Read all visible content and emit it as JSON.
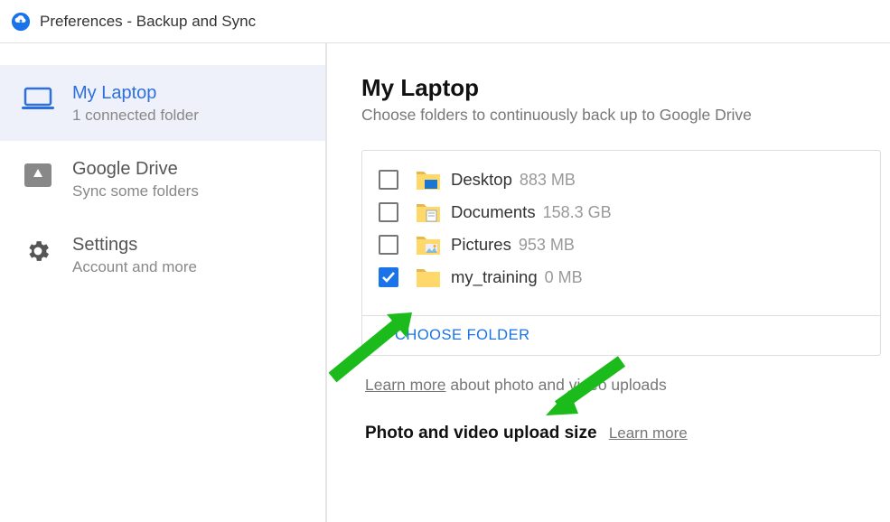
{
  "titlebar": {
    "text": "Preferences - Backup and Sync"
  },
  "sidebar": {
    "items": [
      {
        "title": "My Laptop",
        "sub": "1 connected folder"
      },
      {
        "title": "Google Drive",
        "sub": "Sync some folders"
      },
      {
        "title": "Settings",
        "sub": "Account and more"
      }
    ]
  },
  "main": {
    "title": "My Laptop",
    "subtitle": "Choose folders to continuously back up to Google Drive",
    "folders": [
      {
        "name": "Desktop",
        "size": "883 MB",
        "checked": false
      },
      {
        "name": "Documents",
        "size": "158.3 GB",
        "checked": false
      },
      {
        "name": "Pictures",
        "size": "953 MB",
        "checked": false
      },
      {
        "name": "my_training",
        "size": "0 MB",
        "checked": true
      }
    ],
    "choose_label": "CHOOSE FOLDER",
    "learn_more": "Learn more",
    "upload_note_rest": " about photo and video uploads",
    "section": "Photo and video upload size",
    "section_learn": "Learn more"
  }
}
